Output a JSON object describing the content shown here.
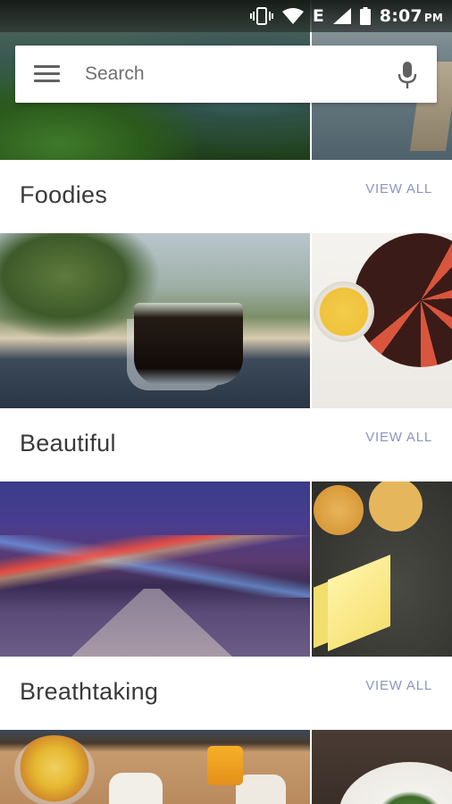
{
  "status_bar": {
    "network_label": "E",
    "time": "8:07",
    "ampm": "PM",
    "icons": [
      "vibrate-icon",
      "wifi-icon",
      "signal-icon",
      "battery-icon"
    ]
  },
  "search": {
    "placeholder": "Search",
    "menu_icon": "menu-icon",
    "mic_icon": "mic-icon"
  },
  "sections": [
    {
      "title": "Foodies",
      "view_all": "VIEW ALL"
    },
    {
      "title": "Beautiful",
      "view_all": "VIEW ALL"
    },
    {
      "title": "Breathtaking",
      "view_all": "VIEW ALL"
    }
  ],
  "colors": {
    "accent": "#8a96c0",
    "title_text": "#3a3a3a",
    "search_text": "#6f6f6f"
  }
}
